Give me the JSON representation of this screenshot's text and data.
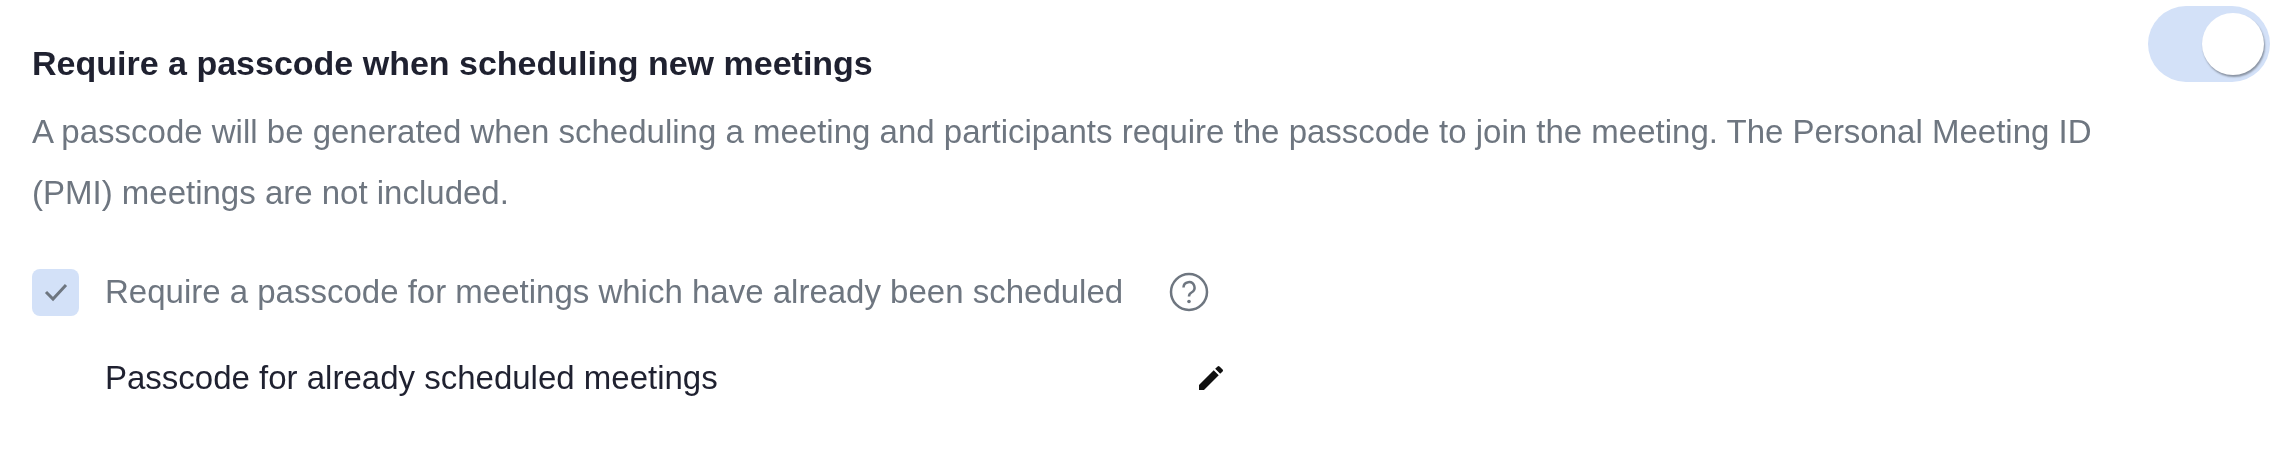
{
  "setting": {
    "title": "Require a passcode when scheduling new meetings",
    "toggle": {
      "on": true,
      "disabled": true
    },
    "description": "A passcode will be generated when scheduling a meeting and participants require the passcode to join the meeting. The Personal Meeting ID (PMI) meetings are not included.",
    "option": {
      "label": "Require a passcode for meetings which have already been scheduled",
      "checked": true,
      "disabled": true
    },
    "passcode_row": {
      "label": "Passcode for already scheduled meetings"
    }
  }
}
